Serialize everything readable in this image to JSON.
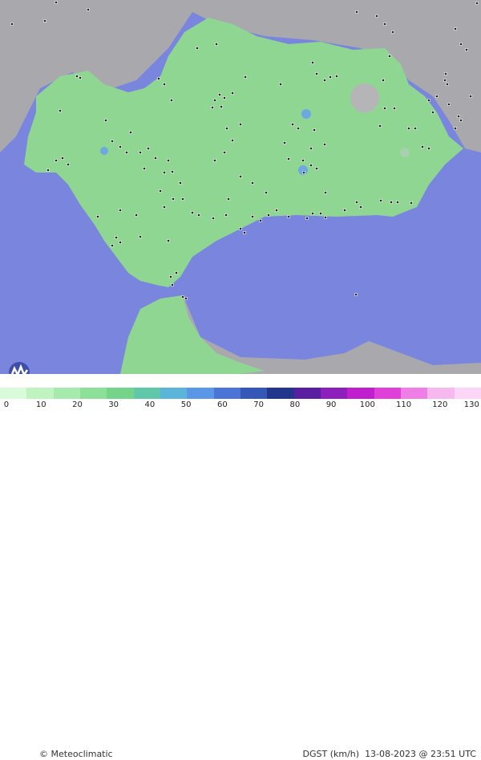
{
  "map": {
    "credit": "© Meteoclimatic",
    "variable": "DGST (km/h)",
    "timestamp": "13-08-2023 @ 23:51 UTC",
    "colors": {
      "sea": "#7a85dd",
      "land": "#8fd693",
      "neighbor": "#a8a8a8",
      "station_marker": "#222222"
    }
  },
  "legend": {
    "ticks": [
      "0",
      "10",
      "20",
      "30",
      "40",
      "50",
      "60",
      "70",
      "80",
      "90",
      "100",
      "110",
      "120",
      "130"
    ],
    "colors": [
      "#d9fbd9",
      "#bff3c0",
      "#a5ebab",
      "#8ce098",
      "#74d48a",
      "#60c7a8",
      "#5ab5d8",
      "#5a97e6",
      "#4a74d6",
      "#3557b8",
      "#22368c",
      "#5a1fa0",
      "#8e1fbf",
      "#c01fd0",
      "#e03fd8",
      "#ef7fe6",
      "#f7b8f0",
      "#fbd6f6"
    ]
  }
}
